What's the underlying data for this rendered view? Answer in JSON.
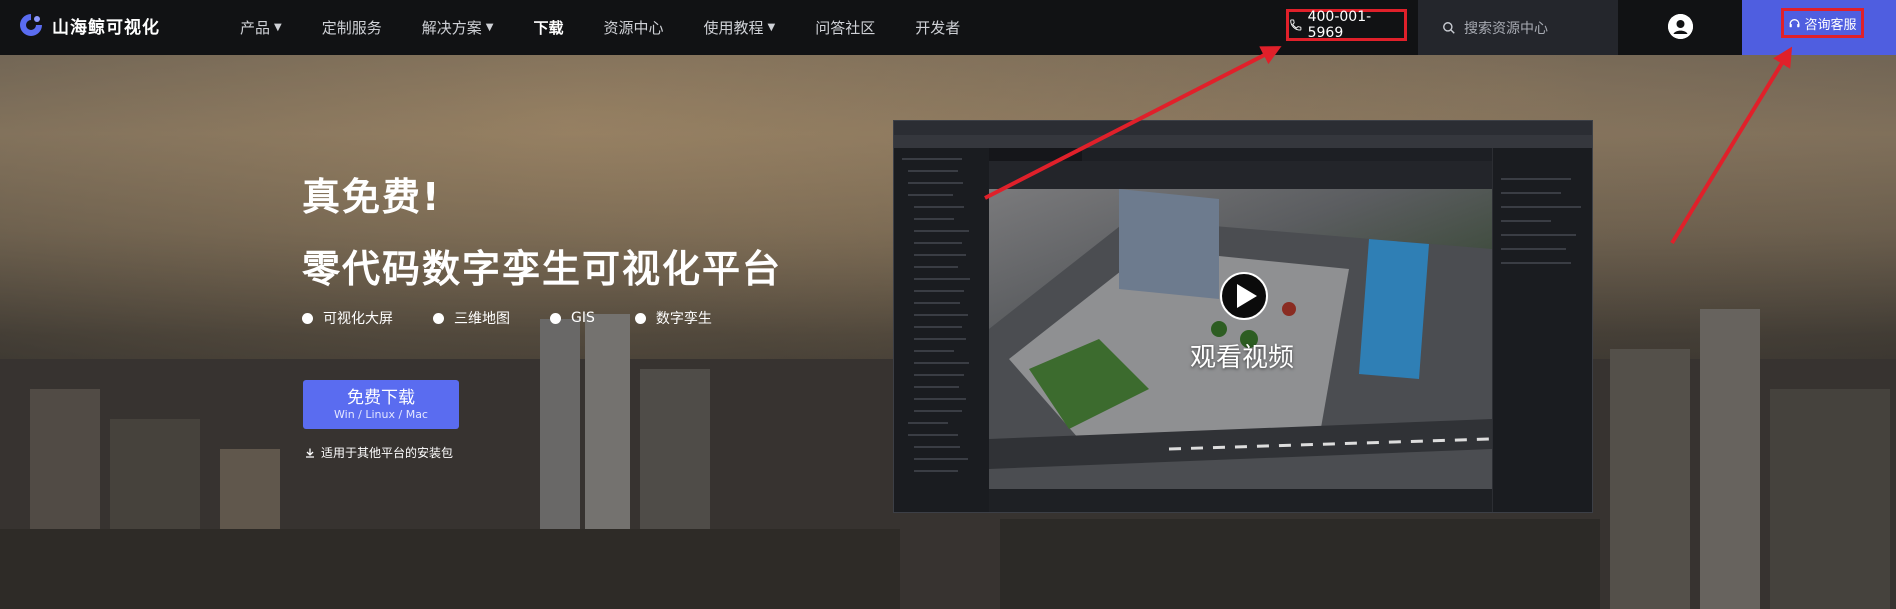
{
  "brand": {
    "name": "山海鲸可视化"
  },
  "nav": {
    "items": [
      {
        "label": "产品",
        "dropdown": true,
        "active": false
      },
      {
        "label": "定制服务",
        "dropdown": false,
        "active": false
      },
      {
        "label": "解决方案",
        "dropdown": true,
        "active": false
      },
      {
        "label": "下载",
        "dropdown": false,
        "active": true
      },
      {
        "label": "资源中心",
        "dropdown": false,
        "active": false
      },
      {
        "label": "使用教程",
        "dropdown": true,
        "active": false
      },
      {
        "label": "问答社区",
        "dropdown": false,
        "active": false
      },
      {
        "label": "开发者",
        "dropdown": false,
        "active": false
      }
    ],
    "phone": "400-001-5969",
    "search_placeholder": "搜索资源中心",
    "consult_label": "咨询客服"
  },
  "hero": {
    "title_line1": "真免费!",
    "title_line2": "零代码数字孪生可视化平台",
    "features": [
      "可视化大屏",
      "三维地图",
      "GIS",
      "数字孪生"
    ],
    "download_button": {
      "label": "免费下载",
      "platforms": "Win / Linux / Mac"
    },
    "other_platforms_link": "适用于其他平台的安装包"
  },
  "video": {
    "watch_label": "观看视频"
  },
  "colors": {
    "nav_bg": "#111214",
    "accent": "#5a6cf0",
    "consult_bg": "#4f5ee0",
    "highlight": "#e0202a"
  }
}
